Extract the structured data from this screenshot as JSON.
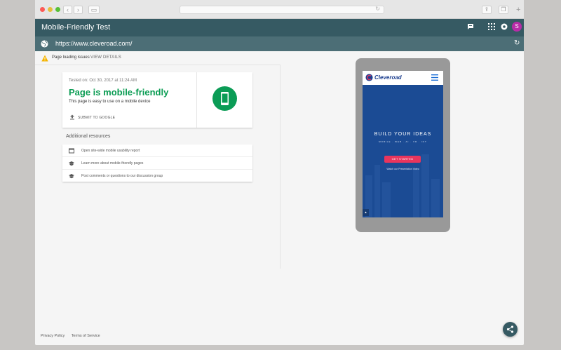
{
  "app": {
    "title": "Mobile-Friendly Test",
    "url": "https://www.cleveroad.com/",
    "avatar_letter": "S"
  },
  "issues": {
    "label": "Page loading issues",
    "link": "VIEW DETAILS"
  },
  "result_card": {
    "tested_on": "Tested on: Oct 30, 2017 at 11:24 AM",
    "headline": "Page is mobile-friendly",
    "subtext": "This page is easy to use on a mobile device",
    "submit_label": "SUBMIT TO GOOGLE"
  },
  "resources": {
    "heading": "Additional resources",
    "items": [
      {
        "label": "Open site-wide mobile usability report",
        "icon": "report-icon"
      },
      {
        "label": "Learn more about mobile-friendly pages",
        "icon": "school-icon"
      },
      {
        "label": "Post comments or questions to our discussion group",
        "icon": "school-icon"
      }
    ]
  },
  "preview": {
    "brand": "Cleveroad",
    "hero_title": "BUILD YOUR IDEAS",
    "hero_sub": "MOBILE · WEB · AI · VR · IOT",
    "cta": "GET STARTED",
    "watch": "Watch our Presentation Video"
  },
  "footer": {
    "privacy": "Privacy Policy",
    "terms": "Terms of Service"
  },
  "colors": {
    "header": "#365a63",
    "urlbar": "#4c6e76",
    "success": "#0a9c53",
    "hero": "#1b4b94",
    "cta": "#e8355d"
  }
}
